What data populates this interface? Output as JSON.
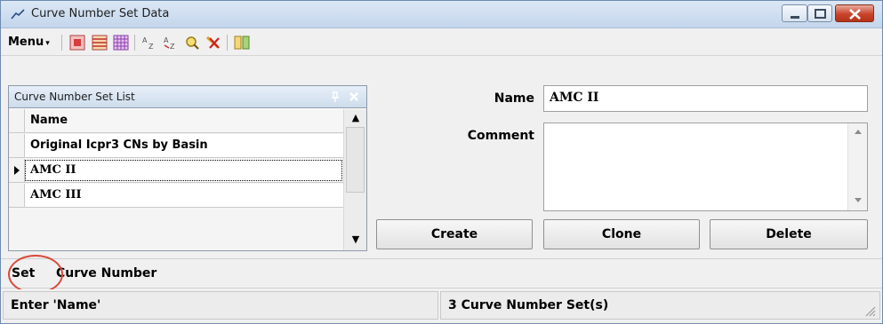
{
  "window": {
    "title": "Curve Number Set Data",
    "icon": "curve-app-icon"
  },
  "toolbar": {
    "menu_label": "Menu",
    "icons": [
      "select-grid-icon",
      "rows-icon",
      "columns-grid-icon",
      "sort-ascending-icon",
      "sort-descending-icon",
      "find-icon",
      "clear-filter-icon",
      "split-view-icon"
    ]
  },
  "list_panel": {
    "title": "Curve Number Set List",
    "column_header": "Name",
    "rows": [
      "Original Icpr3 CNs by Basin",
      "AMC II",
      "AMC III"
    ],
    "current_row_index": 1
  },
  "form": {
    "name_label": "Name",
    "name_value": "AMC II",
    "comment_label": "Comment",
    "comment_value": ""
  },
  "buttons": {
    "create": "Create",
    "clone": "Clone",
    "delete": "Delete"
  },
  "tabs": {
    "set": "Set",
    "curve_number": "Curve Number"
  },
  "status": {
    "left": "Enter 'Name'",
    "right": "3 Curve Number Set(s)"
  },
  "colors": {
    "annotation_circle": "#d84a3a",
    "close_button": "#c8442b",
    "titlebar": "#c4d6ec"
  }
}
